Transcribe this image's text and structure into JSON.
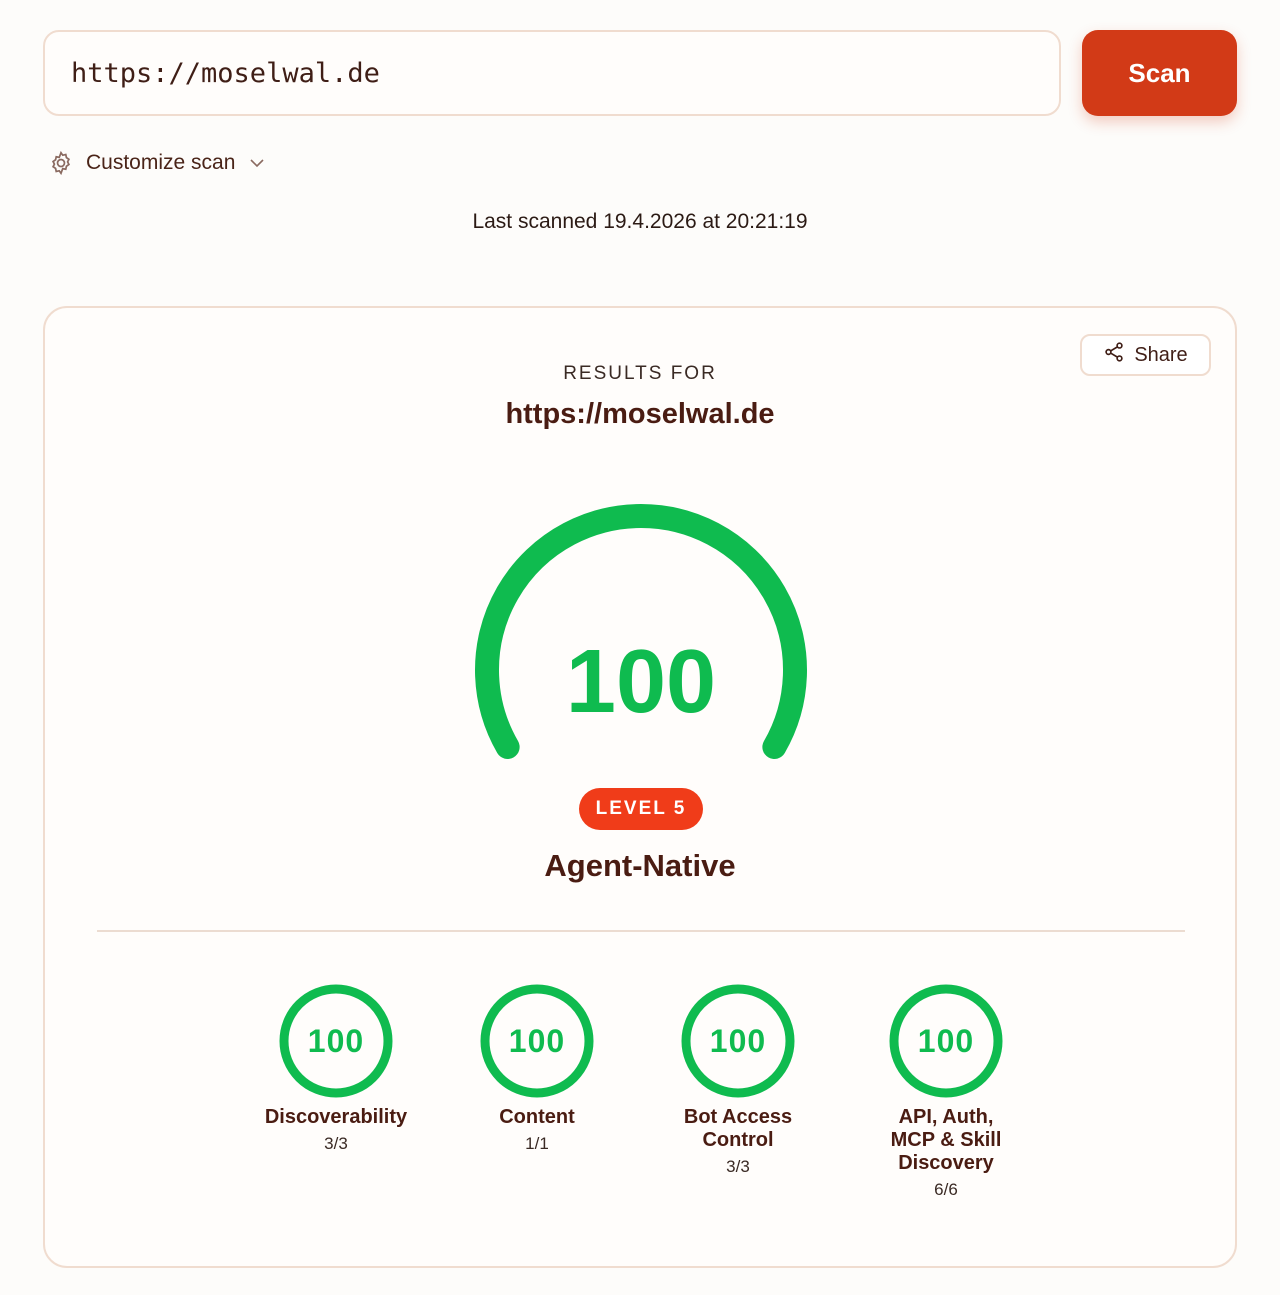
{
  "search": {
    "value": "https://moselwal.de",
    "button_label": "Scan"
  },
  "customize": {
    "label": "Customize scan"
  },
  "last_scanned": "Last scanned 19.4.2026 at 20:21:19",
  "results": {
    "heading": "RESULTS FOR",
    "url": "https://moselwal.de",
    "share_label": "Share",
    "score": "100",
    "score_fraction": 1.0,
    "level_badge": "LEVEL 5",
    "level_name": "Agent-Native",
    "categories": [
      {
        "name": "Discoverability",
        "label_lines": [
          "Discoverability"
        ],
        "score": "100",
        "count": "3/3"
      },
      {
        "name": "Content",
        "label_lines": [
          "Content"
        ],
        "score": "100",
        "count": "1/1"
      },
      {
        "name": "Bot Access Control",
        "label_lines": [
          "Bot Access",
          "Control"
        ],
        "score": "100",
        "count": "3/3"
      },
      {
        "name": "API, Auth, MCP & Skill Discovery",
        "label_lines": [
          "API, Auth,",
          "MCP & Skill",
          "Discovery"
        ],
        "score": "100",
        "count": "6/6"
      }
    ]
  },
  "colors": {
    "accent": "#d23a17",
    "score_green": "#0fbb4f",
    "badge": "#f03c19",
    "text": "#4a1c12"
  },
  "icons": {
    "customize": "gear-icon",
    "customize_chevron": "chevron-down-icon",
    "share": "share-icon"
  }
}
